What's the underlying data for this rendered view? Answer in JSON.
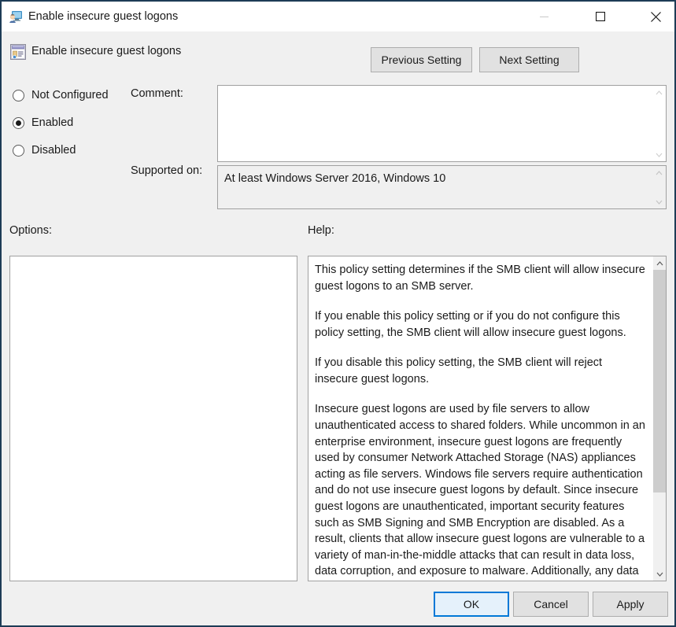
{
  "window": {
    "title": "Enable insecure guest logons",
    "icon": "policy-computer-icon",
    "controls": {
      "minimize_label": "Minimize",
      "maximize_label": "Maximize",
      "close_label": "Close"
    },
    "border_color": "#1d3c56",
    "body_color": "#f0f0f0"
  },
  "header": {
    "icon": "policy-setting-icon",
    "title": "Enable insecure guest logons",
    "previous_button": "Previous Setting",
    "next_button": "Next Setting"
  },
  "state": {
    "options": [
      {
        "id": "not-configured",
        "label": "Not Configured",
        "selected": false
      },
      {
        "id": "enabled",
        "label": "Enabled",
        "selected": true
      },
      {
        "id": "disabled",
        "label": "Disabled",
        "selected": false
      }
    ],
    "selected_value": "Enabled"
  },
  "comment": {
    "label": "Comment:",
    "value": "",
    "editable": true
  },
  "supported_on": {
    "label": "Supported on:",
    "value": "At least Windows Server 2016, Windows 10",
    "editable": false
  },
  "options_panel": {
    "label": "Options:",
    "value": ""
  },
  "help_panel": {
    "label": "Help:",
    "paragraphs": [
      "This policy setting determines if the SMB client will allow insecure guest logons to an SMB server.",
      "If you enable this policy setting or if you do not configure this policy setting, the SMB client will allow insecure guest logons.",
      "If you disable this policy setting, the SMB client will reject insecure guest logons.",
      "Insecure guest logons are used by file servers to allow unauthenticated access to shared folders. While uncommon in an enterprise environment, insecure guest logons are frequently used by consumer Network Attached Storage (NAS) appliances acting as file servers. Windows file servers require authentication and do not use insecure guest logons by default. Since insecure guest logons are unauthenticated, important security features such as SMB Signing and SMB Encryption are disabled. As a result, clients that allow insecure guest logons are vulnerable to a variety of man-in-the-middle attacks that can result in data loss, data corruption, and exposure to malware. Additionally, any data"
    ]
  },
  "footer": {
    "ok_label": "OK",
    "cancel_label": "Cancel",
    "apply_label": "Apply",
    "default_button": "OK",
    "focus_color": "#0078d7"
  }
}
